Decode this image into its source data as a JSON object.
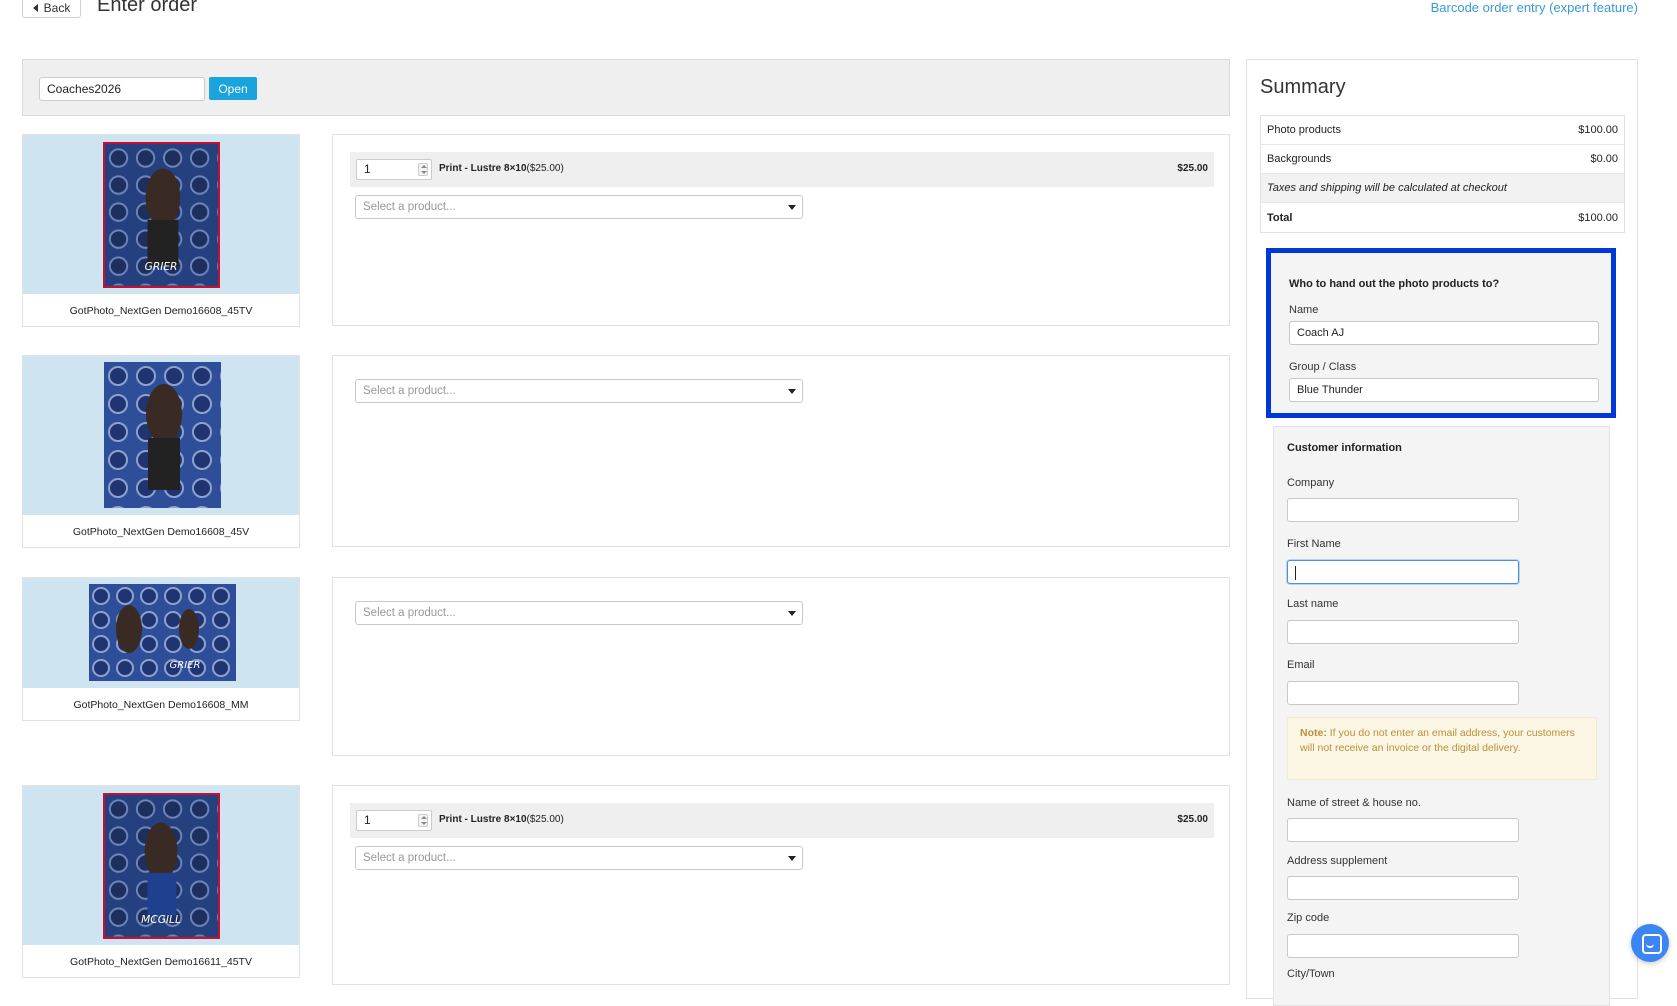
{
  "header": {
    "back_label": "Back",
    "title": "Enter order",
    "barcode_link": "Barcode order entry (expert feature)"
  },
  "code_bar": {
    "code_value": "Coaches2026",
    "open_label": "Open"
  },
  "photos": [
    {
      "caption": "GotPhoto_NextGen Demo16608_45TV"
    },
    {
      "caption": "GotPhoto_NextGen Demo16608_45V"
    },
    {
      "caption": "GotPhoto_NextGen Demo16608_MM"
    },
    {
      "caption": "GotPhoto_NextGen Demo16611_45TV"
    }
  ],
  "orders": [
    {
      "qty": "1",
      "product_name": "Print - Lustre 8×10",
      "product_unit": "($25.00)",
      "price": "$25.00",
      "select_placeholder": "Select a product..."
    },
    {
      "select_placeholder": "Select a product..."
    },
    {
      "select_placeholder": "Select a product..."
    },
    {
      "qty": "1",
      "product_name": "Print - Lustre 8×10",
      "product_unit": "($25.00)",
      "price": "$25.00",
      "select_placeholder": "Select a product..."
    }
  ],
  "summary": {
    "title": "Summary",
    "rows": [
      {
        "label": "Photo products",
        "value": "$100.00"
      },
      {
        "label": "Backgrounds",
        "value": "$0.00"
      }
    ],
    "tax_note": "Taxes and shipping will be calculated at checkout",
    "total_label": "Total",
    "total_value": "$100.00"
  },
  "handout": {
    "title": "Who to hand out the photo products to?",
    "name_label": "Name",
    "name_value": "Coach AJ",
    "group_label": "Group / Class",
    "group_value": "Blue Thunder",
    "highlight_color": "#0037d8"
  },
  "customer": {
    "title": "Customer information",
    "company_label": "Company",
    "first_name_label": "First Name",
    "last_name_label": "Last name",
    "email_label": "Email",
    "note_prefix": "Note:",
    "note_text": " If you do not enter an email address, your customers will not receive an invoice or the digital delivery.",
    "street_label": "Name of street & house no.",
    "address_supplement_label": "Address supplement",
    "zip_label": "Zip code",
    "city_label": "City/Town"
  },
  "colors": {
    "accent": "#1aa3dc",
    "link": "#3a9ad9",
    "photo_bg": "#cfe4f1",
    "note_text": "#b9903d"
  }
}
